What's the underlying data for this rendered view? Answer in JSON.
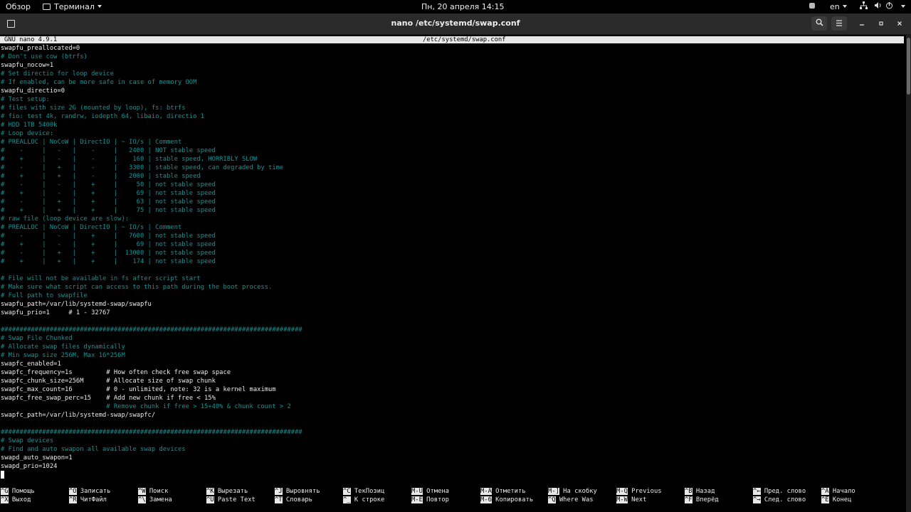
{
  "topbar": {
    "activities": "Обзор",
    "app_menu": "Терминал",
    "clock": "Пн, 20 апреля  14:15",
    "language": "en",
    "icons": [
      "accessibility-icon",
      "network-icon",
      "volume-icon",
      "power-icon"
    ]
  },
  "window": {
    "title": "nano /etc/systemd/swap.conf",
    "buttons": [
      "new-tab-icon",
      "search-icon",
      "hamburger-menu-icon",
      "minimize-icon",
      "maximize-icon",
      "close-icon"
    ]
  },
  "nano": {
    "version": "GNU nano 4.9.1",
    "filename": "/etc/systemd/swap.conf",
    "lines": [
      "swapfu_preallocated=0",
      "# Don't use cow (btrfs)",
      "swapfu_nocow=1",
      "# Set directio for loop device",
      "# If enabled, can be more safe in case of memory OOM",
      "swapfu_directio=0",
      "# Test setup:",
      "# files with size 2G (mounted by loop), fs: btrfs",
      "# fio: test 4k, randrw, iodepth 64, libaio, directio 1",
      "# HDD 1TB 5400k",
      "# Loop device:",
      "# PREALLOC | NoCoW | DirectIO | ~ IO/s | Comment",
      "#    -     |   -   |    -     |   2400 | NOT stable speed",
      "#    +     |   -   |    -     |    160 | stable speed, HORRIBLY SLOW",
      "#    -     |   +   |    -     |   3300 | stable speed, can degraded by time",
      "#    +     |   +   |    -     |   2000 | stable speed",
      "#    -     |   -   |    +     |     50 | not stable speed",
      "#    +     |   -   |    +     |     69 | not stable speed",
      "#    -     |   +   |    +     |     63 | not stable speed",
      "#    +     |   +   |    +     |     75 | not stable speed",
      "# raw file (loop device are slow):",
      "# PREALLOC | NoCoW | DirectIO | ~ IO/s | Comment",
      "#    -     |   -   |    +     |   7600 | not stable speed",
      "#    +     |   -   |    +     |     69 | not stable speed",
      "#    -     |   +   |    +     |  13000 | not stable speed",
      "#    +     |   +   |    +     |    174 | not stable speed",
      "",
      "# File will not be available in fs after script start",
      "# Make sure what script can access to this path during the boot process.",
      "# Full path to swapfile",
      "swapfu_path=/var/lib/systemd-swap/swapfu",
      "swapfu_prio=1     # 1 - 32767",
      "",
      "################################################################################",
      "# Swap File Chunked",
      "# Allocate swap files dynamically",
      "# Min swap size 256M, Max 16*256M",
      "swapfc_enabled=1",
      "swapfc_frequency=1s         # How often check free swap space",
      "swapfc_chunk_size=256M      # Allocate size of swap chunk",
      "swapfc_max_count=16         # 0 - unlimited, note: 32 is a kernel maximum",
      "swapfc_free_swap_perc=15    # Add new chunk if free < 15%",
      "                            # Remove chunk if free > 15+40% & chunk count > 2",
      "swapfc_path=/var/lib/systemd-swap/swapfc/",
      "",
      "################################################################################",
      "# Swap devices",
      "# Find and auto swapon all available swap devices",
      "swapd_auto_swapon=1",
      "swapd_prio=1024",
      ""
    ],
    "shortcuts": [
      [
        {
          "key": "^G",
          "label": "Помощь"
        },
        {
          "key": "^X",
          "label": "Выход"
        }
      ],
      [
        {
          "key": "^O",
          "label": "Записать"
        },
        {
          "key": "^R",
          "label": "ЧитФайл"
        }
      ],
      [
        {
          "key": "^W",
          "label": "Поиск"
        },
        {
          "key": "^\\",
          "label": "Замена"
        }
      ],
      [
        {
          "key": "^K",
          "label": "Вырезать"
        },
        {
          "key": "^U",
          "label": "Paste Text"
        }
      ],
      [
        {
          "key": "^J",
          "label": "Выровнять"
        },
        {
          "key": "^T",
          "label": "Словарь"
        }
      ],
      [
        {
          "key": "^C",
          "label": "ТекПозиц"
        },
        {
          "key": "^_",
          "label": "К строке"
        }
      ],
      [
        {
          "key": "M-U",
          "label": "Отмена"
        },
        {
          "key": "M-E",
          "label": "Повтор"
        }
      ],
      [
        {
          "key": "M-A",
          "label": "Отметить"
        },
        {
          "key": "M-6",
          "label": "Копировать"
        }
      ],
      [
        {
          "key": "M-]",
          "label": "На скобку"
        },
        {
          "key": "^Q",
          "label": "Where Was"
        }
      ],
      [
        {
          "key": "M-Q",
          "label": "Previous"
        },
        {
          "key": "M-W",
          "label": "Next"
        }
      ],
      [
        {
          "key": "^B",
          "label": "Назад"
        },
        {
          "key": "^F",
          "label": "Вперёд"
        }
      ],
      [
        {
          "key": "^←",
          "label": "Пред. слово"
        },
        {
          "key": "^→",
          "label": "След. слово"
        }
      ],
      [
        {
          "key": "^A",
          "label": "Начало"
        },
        {
          "key": "^E",
          "label": "Конец"
        }
      ]
    ]
  }
}
